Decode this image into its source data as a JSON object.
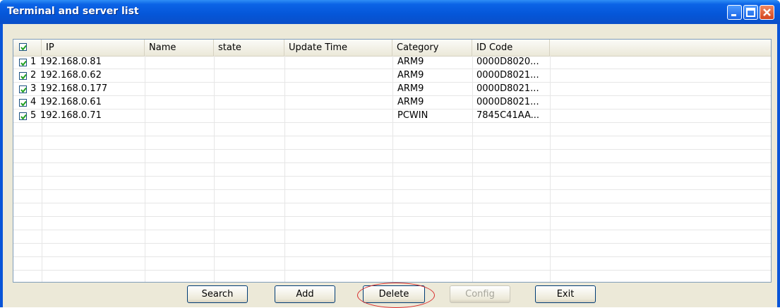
{
  "window": {
    "title": "Terminal and server list"
  },
  "columns": [
    "IP",
    "Name",
    "state",
    "Update Time",
    "Category",
    "ID Code"
  ],
  "rows": [
    {
      "index": "1",
      "ip": "192.168.0.81",
      "name": "",
      "state": "",
      "update_time": "",
      "category": "ARM9",
      "id_code": "0000D8020...",
      "checked": true
    },
    {
      "index": "2",
      "ip": "192.168.0.62",
      "name": "",
      "state": "",
      "update_time": "",
      "category": "ARM9",
      "id_code": "0000D8021...",
      "checked": true
    },
    {
      "index": "3",
      "ip": "192.168.0.177",
      "name": "",
      "state": "",
      "update_time": "",
      "category": "ARM9",
      "id_code": "0000D8021...",
      "checked": true
    },
    {
      "index": "4",
      "ip": "192.168.0.61",
      "name": "",
      "state": "",
      "update_time": "",
      "category": "ARM9",
      "id_code": "0000D8021...",
      "checked": true
    },
    {
      "index": "5",
      "ip": "192.168.0.71",
      "name": "",
      "state": "",
      "update_time": "",
      "category": "PCWIN",
      "id_code": "7845C41AA...",
      "checked": true
    }
  ],
  "buttons": {
    "search": "Search",
    "add": "Add",
    "delete": "Delete",
    "config": "Config",
    "exit": "Exit"
  },
  "select_all_checked": true,
  "icons": {
    "minimize": "minimize-icon",
    "maximize": "maximize-icon",
    "close": "close-icon"
  },
  "colors": {
    "titlebar": "#0556d8",
    "highlight": "#d82b2b",
    "checkmark": "#21a121"
  }
}
